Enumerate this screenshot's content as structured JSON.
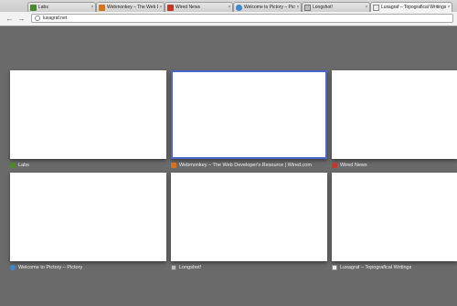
{
  "tabs": [
    {
      "title": "Labs",
      "favicon": "labs-icon"
    },
    {
      "title": "Webmonkey – The Web Developer's Resource",
      "favicon": "webmonkey-icon"
    },
    {
      "title": "Wired News",
      "favicon": "wired-icon"
    },
    {
      "title": "Welcome to Pictory – Pictory",
      "favicon": "pictory-icon"
    },
    {
      "title": "Longshot!",
      "favicon": "longshot-icon"
    },
    {
      "title": "Luxagraf – Topografical Writings",
      "favicon": "luxagraf-icon",
      "active": true
    }
  ],
  "toolbar": {
    "back_icon": "back-arrow-icon",
    "forward_icon": "forward-arrow-icon",
    "url": "luxagraf.net"
  },
  "thumbnails": [
    {
      "label": "Labs",
      "favicon": "labs-icon"
    },
    {
      "label": "Webmonkey – The Web Developer's Resource | Wired.com",
      "favicon": "webmonkey-icon",
      "selected": true
    },
    {
      "label": "Wired News",
      "favicon": "wired-icon"
    },
    {
      "label": "Welcome to Pictory – Pictory",
      "favicon": "pictory-icon"
    },
    {
      "label": "Longshot!",
      "favicon": "longshot-icon"
    },
    {
      "label": "Luxagraf – Topografical Writings",
      "favicon": "luxagraf-icon"
    }
  ],
  "colors": {
    "page_background": "#6a6a6a",
    "selection_border": "#4a66cc"
  }
}
